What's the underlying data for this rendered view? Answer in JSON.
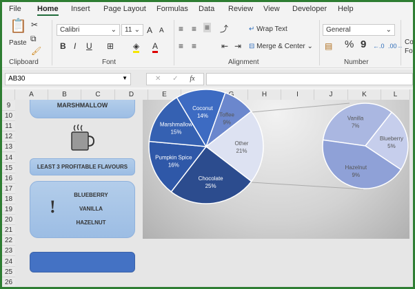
{
  "tabs": [
    "File",
    "Home",
    "Insert",
    "Page Layout",
    "Formulas",
    "Data",
    "Review",
    "View",
    "Developer",
    "Help"
  ],
  "active_tab": "Home",
  "ribbon": {
    "paste": "Paste",
    "clipboard": "Clipboard",
    "font_name": "Calibri",
    "font_size": "11",
    "font": "Font",
    "bold": "B",
    "italic": "I",
    "underline": "U",
    "wrap_text": "Wrap Text",
    "merge_center": "Merge & Center",
    "alignment": "Alignment",
    "number_format": "General",
    "number": "Number",
    "percent": "%",
    "comma": "9",
    "cond_format": "Co Fo"
  },
  "formula_bar": {
    "name_box": "AB30",
    "formula": "",
    "fx": "fx"
  },
  "columns": [
    "A",
    "B",
    "C",
    "D",
    "E",
    "F",
    "G",
    "H",
    "I",
    "J",
    "K",
    "L"
  ],
  "rows": [
    "9",
    "10",
    "11",
    "12",
    "13",
    "14",
    "15",
    "16",
    "17",
    "18",
    "19",
    "20",
    "21",
    "22",
    "23",
    "24",
    "25",
    "26"
  ],
  "shapes": {
    "top_box_text": "MARSHMALLOW",
    "least_title": "LEAST 3 PROFITABLE FLAVOURS",
    "least_items": [
      "BLUEBERRY",
      "VANILLA",
      "HAZELNUT"
    ],
    "exclaim": "!"
  },
  "chart_data": {
    "type": "pie",
    "subtype": "pie-of-pie",
    "main": [
      {
        "label": "Other",
        "value": 21,
        "color": "#dde2f2"
      },
      {
        "label": "Chocolate",
        "value": 25,
        "color": "#2c4c8e"
      },
      {
        "label": "Pumpkin Spice",
        "value": 16,
        "color": "#2f58a8"
      },
      {
        "label": "Marshmallow",
        "value": 15,
        "color": "#3561b2"
      },
      {
        "label": "Coconut",
        "value": 14,
        "color": "#3d6bc2"
      },
      {
        "label": "Toffee",
        "value": 9,
        "color": "#6b87cd"
      }
    ],
    "secondary": [
      {
        "label": "Vanilla",
        "value": 7,
        "color": "#aab7e1"
      },
      {
        "label": "Blueberry",
        "value": 5,
        "color": "#c6ceec"
      },
      {
        "label": "Hazelnut",
        "value": 9,
        "color": "#8fa1d7"
      }
    ]
  }
}
